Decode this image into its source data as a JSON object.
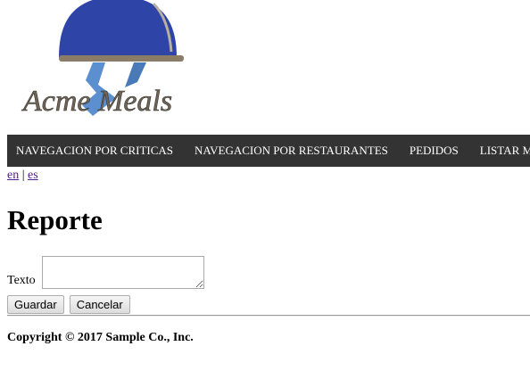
{
  "logo": {
    "text": "Acme Meals",
    "icon": "cloche-tray-icon",
    "colors": {
      "dome": "#2f44a7",
      "tray": "#8a7c66",
      "hand": "#5b8fd0",
      "text": "#6e6558"
    }
  },
  "nav": {
    "items": [
      {
        "label": "NAVEGACION POR CRITICAS"
      },
      {
        "label": "NAVEGACION POR RESTAURANTES"
      },
      {
        "label": "PEDIDOS"
      },
      {
        "label": "LISTAR MIS FAC"
      }
    ],
    "background": "#333333"
  },
  "languages": {
    "en": "en",
    "separator": "|",
    "es": "es"
  },
  "page": {
    "title": "Reporte"
  },
  "form": {
    "text_label": "Texto",
    "text_value": "",
    "save_label": "Guardar",
    "cancel_label": "Cancelar"
  },
  "footer": {
    "copyright": "Copyright © 2017 Sample Co., Inc."
  }
}
